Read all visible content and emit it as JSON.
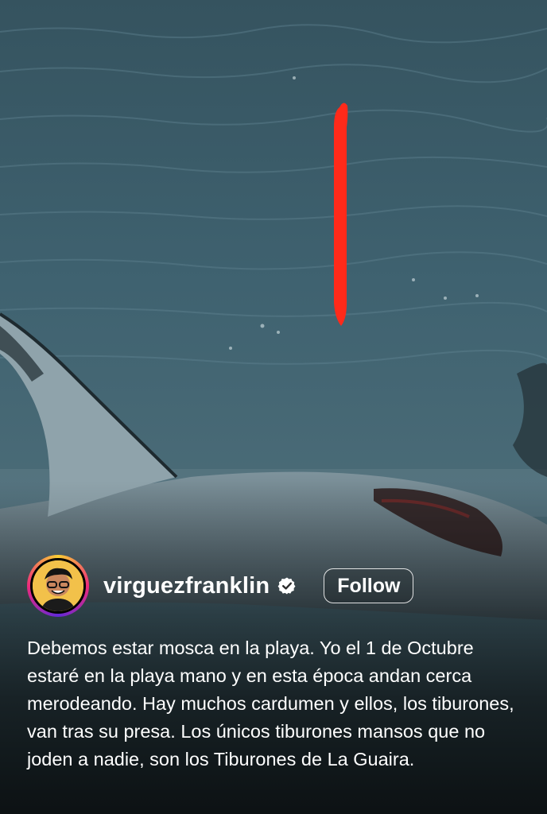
{
  "post": {
    "username": "virguezfranklin",
    "verified": true,
    "follow_label": "Follow",
    "caption": "Debemos estar mosca en la playa. Yo el 1 de Octubre estaré en la playa mano y en esta época andan cerca merodeando. Hay muchos cardumen y ellos, los tiburones, van tras su presa. Los únicos tiburones mansos que no joden  a nadie, son los Tiburones de La Guaira."
  },
  "icons": {
    "verified": "verified-check-icon",
    "avatar": "profile-avatar"
  },
  "colors": {
    "annotation_marker": "#ff2a1a",
    "water": "#3a5d6b",
    "story_ring_start": "#f9ce34",
    "story_ring_mid": "#ee2a7b"
  }
}
